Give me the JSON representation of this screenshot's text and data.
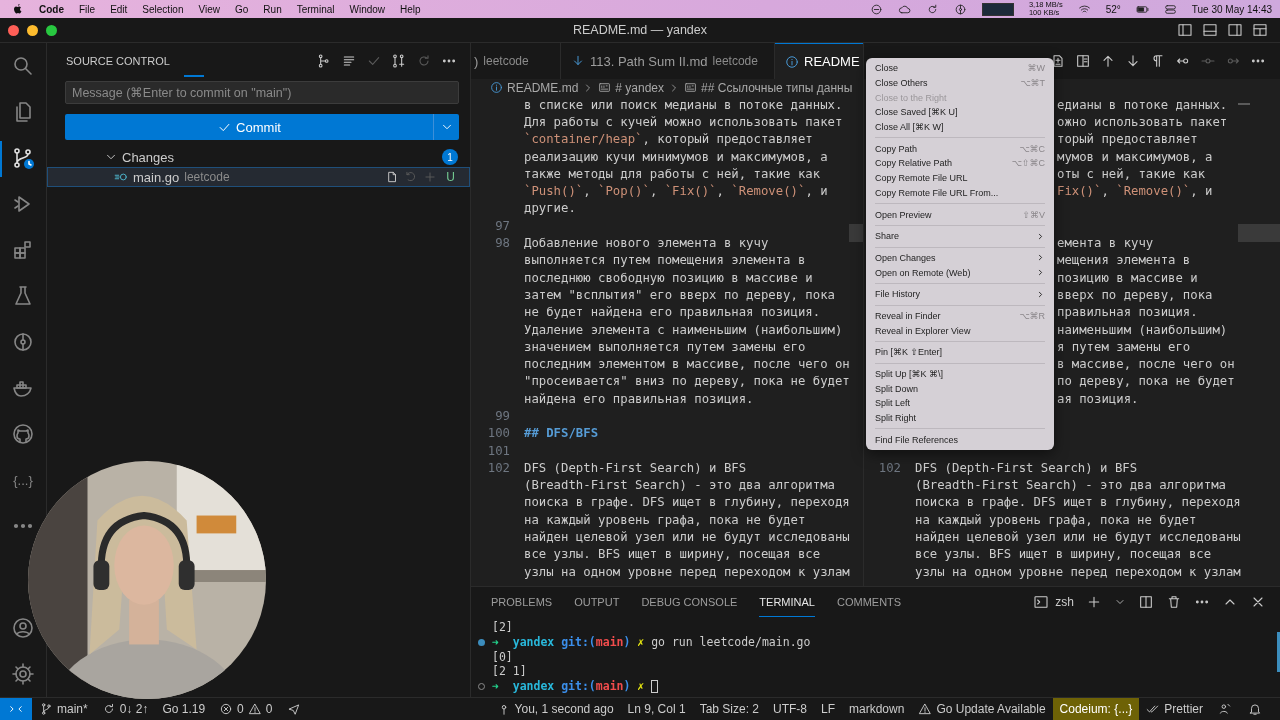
{
  "menubar": {
    "app": "Code",
    "items": [
      "File",
      "Edit",
      "Selection",
      "View",
      "Go",
      "Run",
      "Terminal",
      "Window",
      "Help"
    ],
    "net_up": "3,18 MB/s",
    "net_down": "100 KB/s",
    "temperature": "52°",
    "clock": "Tue 30 May  14:43"
  },
  "window": {
    "title": "README.md — yandex"
  },
  "activity_bar": {
    "top": [
      {
        "kind": "search",
        "selected": false
      },
      {
        "kind": "explorer",
        "selected": false
      },
      {
        "kind": "source-control",
        "selected": true
      },
      {
        "kind": "run",
        "selected": false
      },
      {
        "kind": "extensions",
        "selected": false
      },
      {
        "kind": "testing",
        "selected": false
      },
      {
        "kind": "graph",
        "selected": false
      },
      {
        "kind": "docker",
        "selected": false
      },
      {
        "kind": "github",
        "selected": false
      },
      {
        "kind": "text",
        "label": "{...}",
        "selected": false
      },
      {
        "kind": "more",
        "selected": false
      }
    ],
    "bottom": [
      {
        "kind": "account",
        "selected": false
      },
      {
        "kind": "settings",
        "selected": false
      }
    ]
  },
  "sidebar": {
    "title": "SOURCE CONTROL",
    "message_placeholder": "Message (⌘Enter to commit on \"main\")",
    "commit_label": "Commit",
    "changes": {
      "label": "Changes",
      "count": "1",
      "expanded": true,
      "files": [
        {
          "name": "main.go",
          "folder": "leetcode",
          "status": "U",
          "selected": true
        }
      ]
    }
  },
  "editor": {
    "groups": [
      {
        "tabs": [
          {
            "name": ")",
            "description": "leetcode",
            "kind": "plain",
            "selected": false
          },
          {
            "name": "113. Path Sum II.md",
            "description": "leetcode",
            "kind": "markdown",
            "selected": false
          },
          {
            "name": "README",
            "kind": "info",
            "selected": true
          }
        ],
        "breadcrumb": [
          {
            "text": "README.md",
            "kind": "file"
          },
          {
            "text": "# yandex",
            "kind": "symbol"
          },
          {
            "text": "## Ссылочные типы данны",
            "kind": "symbol"
          }
        ],
        "rows": [
          {
            "kind": "text",
            "text": "в списке или поиск медианы в потоке данных."
          },
          {
            "kind": "text",
            "text": "Для работы с кучей можно использовать пакет"
          },
          {
            "kind": "mixed",
            "parts": [
              {
                "text": "`container/heap`",
                "kind": "code"
              },
              {
                "text": ", который предоставляет",
                "kind": "plain"
              }
            ]
          },
          {
            "kind": "text",
            "text": "реализацию кучи минимумов и максимумов, а"
          },
          {
            "kind": "text",
            "text": "также методы для работы с ней, такие как"
          },
          {
            "kind": "mixed",
            "parts": [
              {
                "text": "`Push()`",
                "kind": "code"
              },
              {
                "text": ", ",
                "kind": "plain"
              },
              {
                "text": "`Pop()`",
                "kind": "code"
              },
              {
                "text": ", ",
                "kind": "plain"
              },
              {
                "text": "`Fix()`",
                "kind": "code"
              },
              {
                "text": ", ",
                "kind": "plain"
              },
              {
                "text": "`Remove()`",
                "kind": "code"
              },
              {
                "text": ", и",
                "kind": "plain"
              }
            ]
          },
          {
            "kind": "text",
            "text": "другие."
          },
          {
            "kind": "blank",
            "num": "97"
          },
          {
            "kind": "text",
            "num": "98",
            "text": "Добавление нового элемента в кучу"
          },
          {
            "kind": "text",
            "text": "выполняется путем помещения элемента в"
          },
          {
            "kind": "text",
            "text": "последнюю свободную позицию в массиве и"
          },
          {
            "kind": "text",
            "text": "затем \"всплытия\" его вверх по дереву, пока"
          },
          {
            "kind": "text",
            "text": "не будет найдена его правильная позиция."
          },
          {
            "kind": "text",
            "text": "Удаление элемента с наименьшим (наибольшим)"
          },
          {
            "kind": "text",
            "text": "значением выполняется путем замены его"
          },
          {
            "kind": "text",
            "text": "последним элементом в массиве, после чего он"
          },
          {
            "kind": "text",
            "text": "\"просеивается\" вниз по дереву, пока не будет"
          },
          {
            "kind": "text",
            "text": "найдена его правильная позиция."
          },
          {
            "kind": "blank",
            "num": "99"
          },
          {
            "kind": "heading",
            "num": "100",
            "text": "## DFS/BFS"
          },
          {
            "kind": "blank",
            "num": "101"
          },
          {
            "kind": "text",
            "num": "102",
            "text": "DFS (Depth-First Search) и BFS"
          },
          {
            "kind": "text",
            "text": "(Breadth-First Search) - это два алгоритма"
          },
          {
            "kind": "text",
            "text": "поиска в графе. DFS ищет в глубину, переходя"
          },
          {
            "kind": "text",
            "text": "на каждый уровень графа, пока не будет"
          },
          {
            "kind": "text",
            "text": "найден целевой узел или не будут исследованы"
          },
          {
            "kind": "text",
            "text": "все узлы. BFS ищет в ширину, посещая все"
          },
          {
            "kind": "text",
            "text": "узлы на одном уровне перед переходом к узлам"
          }
        ]
      },
      {
        "rows_beside_menu": [
          {
            "kind": "text",
            "text": "едианы в потоке данных."
          },
          {
            "kind": "text",
            "text": "ожно использовать пакет"
          },
          {
            "kind": "text",
            "text": "торый предоставляет"
          },
          {
            "kind": "text",
            "text": "мумов и максимумов, а"
          },
          {
            "kind": "text",
            "text": "оты с ней, такие как"
          },
          {
            "kind": "mixed",
            "parts": [
              {
                "text": "Fix()`",
                "kind": "code"
              },
              {
                "text": ", ",
                "kind": "plain"
              },
              {
                "text": "`Remove()`",
                "kind": "code"
              },
              {
                "text": ", и",
                "kind": "plain"
              }
            ]
          },
          {
            "kind": "blank"
          },
          {
            "kind": "blank"
          },
          {
            "kind": "text",
            "text": "емента в кучу"
          },
          {
            "kind": "text",
            "text": "мещения элемента в"
          },
          {
            "kind": "text",
            "text": "позицию в массиве и"
          },
          {
            "kind": "text",
            "text": "вверх по дереву, пока"
          },
          {
            "kind": "text",
            "text": "правильная позиция."
          },
          {
            "kind": "text",
            "text": "наименьшим (наибольшим)"
          },
          {
            "kind": "text",
            "text": "я путем замены его"
          },
          {
            "kind": "text",
            "text": "в массиве, после чего он"
          },
          {
            "kind": "text",
            "text": "по дереву, пока не будет"
          },
          {
            "kind": "text",
            "text": "ая позиция."
          },
          {
            "kind": "blank"
          },
          {
            "kind": "blank"
          },
          {
            "kind": "blank"
          }
        ],
        "rows": [
          {
            "kind": "text",
            "num": "102",
            "text": "DFS (Depth-First Search) и BFS"
          },
          {
            "kind": "text",
            "text": "(Breadth-First Search) - это два алгоритма"
          },
          {
            "kind": "text",
            "text": "поиска в графе. DFS ищет в глубину, переходя"
          },
          {
            "kind": "text",
            "text": "на каждый уровень графа, пока не будет"
          },
          {
            "kind": "text",
            "text": "найден целевой узел или не будут исследованы"
          },
          {
            "kind": "text",
            "text": "все узлы. BFS ищет в ширину, посещая все"
          },
          {
            "kind": "text",
            "text": "узлы на одном уровне перед переходом к узлам"
          }
        ]
      }
    ]
  },
  "context_menu": {
    "groups": [
      [
        {
          "label": "Close",
          "shortcut": "⌘W",
          "disabled": false,
          "submenu": false
        },
        {
          "label": "Close Others",
          "shortcut": "⌥⌘T",
          "disabled": false,
          "submenu": false
        },
        {
          "label": "Close to the Right",
          "disabled": true,
          "submenu": false
        },
        {
          "label": "Close Saved [⌘K U]",
          "disabled": false,
          "submenu": false
        },
        {
          "label": "Close All [⌘K W]",
          "disabled": false,
          "submenu": false
        }
      ],
      [
        {
          "label": "Copy Path",
          "shortcut": "⌥⌘C",
          "disabled": false,
          "submenu": false
        },
        {
          "label": "Copy Relative Path",
          "shortcut": "⌥⇧⌘C",
          "disabled": false,
          "submenu": false
        },
        {
          "label": "Copy Remote File URL",
          "disabled": false,
          "submenu": false
        },
        {
          "label": "Copy Remote File URL From...",
          "disabled": false,
          "submenu": false
        }
      ],
      [
        {
          "label": "Open Preview",
          "shortcut": "⇧⌘V",
          "disabled": false,
          "submenu": false
        }
      ],
      [
        {
          "label": "Share",
          "disabled": false,
          "submenu": true
        }
      ],
      [
        {
          "label": "Open Changes",
          "disabled": false,
          "submenu": true
        },
        {
          "label": "Open on Remote (Web)",
          "disabled": false,
          "submenu": true
        }
      ],
      [
        {
          "label": "File History",
          "disabled": false,
          "submenu": true
        }
      ],
      [
        {
          "label": "Reveal in Finder",
          "shortcut": "⌥⌘R",
          "disabled": false,
          "submenu": false
        },
        {
          "label": "Reveal in Explorer View",
          "disabled": false,
          "submenu": false
        }
      ],
      [
        {
          "label": "Pin [⌘K ⇧Enter]",
          "disabled": false,
          "submenu": false
        }
      ],
      [
        {
          "label": "Split Up [⌘K ⌘\\]",
          "disabled": false,
          "submenu": false
        },
        {
          "label": "Split Down",
          "disabled": false,
          "submenu": false
        },
        {
          "label": "Split Left",
          "disabled": false,
          "submenu": false
        },
        {
          "label": "Split Right",
          "disabled": false,
          "submenu": false
        }
      ],
      [
        {
          "label": "Find File References",
          "disabled": false,
          "submenu": false
        }
      ]
    ]
  },
  "panel": {
    "tabs": [
      {
        "label": "PROBLEMS",
        "selected": false
      },
      {
        "label": "OUTPUT",
        "selected": false
      },
      {
        "label": "DEBUG CONSOLE",
        "selected": false
      },
      {
        "label": "TERMINAL",
        "selected": true
      },
      {
        "label": "COMMENTS",
        "selected": false
      }
    ],
    "shell": "zsh",
    "lines": [
      {
        "kind": "output",
        "text": "[2]"
      },
      {
        "kind": "prompt",
        "success": true,
        "parts": [
          {
            "text": "➜",
            "kind": "arrow"
          },
          {
            "text": "yandex",
            "kind": "dir"
          },
          {
            "text": "git:(",
            "kind": "git"
          },
          {
            "text": "main",
            "kind": "branch"
          },
          {
            "text": ")",
            "kind": "git"
          },
          {
            "text": "✗",
            "kind": "dirty"
          },
          {
            "text": "go run leetcode/main.go",
            "kind": "plain"
          }
        ],
        "cursor": false
      },
      {
        "kind": "output",
        "text": "[0]"
      },
      {
        "kind": "output",
        "text": "[2 1]"
      },
      {
        "kind": "prompt",
        "success": false,
        "parts": [
          {
            "text": "➜",
            "kind": "arrow"
          },
          {
            "text": "yandex",
            "kind": "dir"
          },
          {
            "text": "git:(",
            "kind": "git"
          },
          {
            "text": "main",
            "kind": "branch"
          },
          {
            "text": ")",
            "kind": "git"
          },
          {
            "text": "✗",
            "kind": "dirty"
          }
        ],
        "cursor": true
      }
    ]
  },
  "status_bar": {
    "left": [
      {
        "kind": "remote"
      },
      {
        "kind": "branch",
        "text": "main*"
      },
      {
        "kind": "sync",
        "text": "0↓ 2↑"
      },
      {
        "kind": "plain",
        "text": "Go 1.19"
      },
      {
        "kind": "problems",
        "errors": "0",
        "warnings": "0"
      },
      {
        "kind": "send"
      }
    ],
    "right": [
      {
        "kind": "blame",
        "text": "You, 1 second ago"
      },
      {
        "kind": "plain",
        "text": "Ln 9, Col 1"
      },
      {
        "kind": "plain",
        "text": "Tab Size: 2"
      },
      {
        "kind": "plain",
        "text": "UTF-8"
      },
      {
        "kind": "plain",
        "text": "LF"
      },
      {
        "kind": "plain",
        "text": "markdown"
      },
      {
        "kind": "warning",
        "text": "Go Update Available"
      },
      {
        "kind": "highlight",
        "text": "Codeium: {...}"
      },
      {
        "kind": "check",
        "text": "Prettier"
      },
      {
        "kind": "feedback"
      },
      {
        "kind": "bell"
      }
    ]
  }
}
